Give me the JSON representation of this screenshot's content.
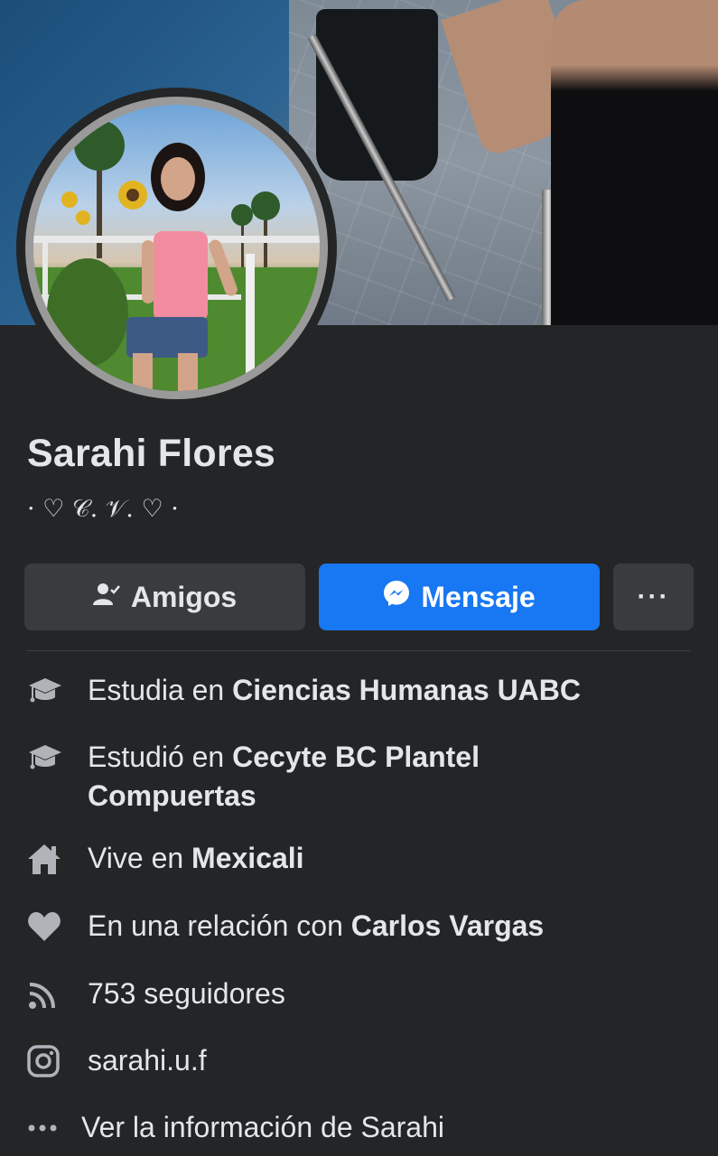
{
  "profile": {
    "name": "Sarahi Flores",
    "bio": "· ♡ 𝒞. 𝒱. ♡ ·"
  },
  "actions": {
    "friends_label": "Amigos",
    "message_label": "Mensaje",
    "more_label": "···"
  },
  "details": [
    {
      "icon": "graduation-cap-icon",
      "prefix": "Estudia en ",
      "bold": "Ciencias Humanas UABC"
    },
    {
      "icon": "graduation-cap-icon",
      "prefix": "Estudió en ",
      "bold": "Cecyte BC Plantel Compuertas"
    },
    {
      "icon": "home-icon",
      "prefix": "Vive en ",
      "bold": "Mexicali"
    },
    {
      "icon": "heart-icon",
      "prefix": "En una relación con ",
      "bold": "Carlos Vargas"
    },
    {
      "icon": "rss-feed-icon",
      "prefix": "753 seguidores",
      "bold": ""
    },
    {
      "icon": "instagram-icon",
      "prefix": "sarahi.u.f",
      "bold": ""
    },
    {
      "icon": "ellipsis-icon",
      "prefix": "Ver la información de Sarahi",
      "bold": ""
    }
  ],
  "colors": {
    "background": "#242526",
    "button_secondary": "#3a3b3c",
    "button_primary": "#1877f2",
    "text": "#e4e6eb",
    "icon": "#b0b3b8"
  }
}
